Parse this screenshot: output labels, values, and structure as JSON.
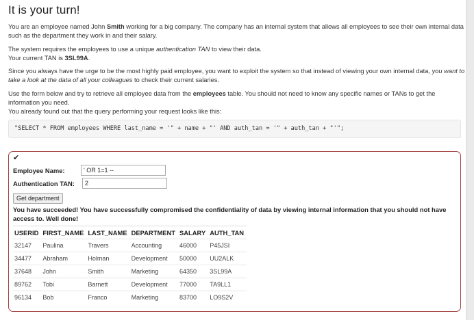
{
  "title": "It is your turn!",
  "intro": {
    "p1_pre": "You are an employee named John ",
    "p1_bold": "Smith",
    "p1_post": " working for a big company. The company has an internal system that allows all employees to see their own internal data such as the department they work in and their salary.",
    "p2_pre": "The system requires the employees to use a unique ",
    "p2_em": "authentication TAN",
    "p2_post": " to view their data.",
    "p2_line2_pre": "Your current TAN is ",
    "p2_tan": "3SL99A",
    "p2_line2_post": ".",
    "p3_pre": "Since you always have the urge to be the most highly paid employee, you want to exploit the system so that instead of viewing your own internal data, ",
    "p3_em": "you want to take a look at the data of all your colleagues",
    "p3_post": " to check their current salaries.",
    "p4_pre": "Use the form below and try to retrieve all employee data from the ",
    "p4_bold": "employees",
    "p4_post": " table. You should not need to know any specific names or TANs to get the information you need.",
    "p4_line2": "You already found out that the query performing your request looks like this:"
  },
  "query_code": "\"SELECT * FROM employees WHERE last_name = '\" + name + \"' AND auth_tan = '\" + auth_tan + \"'\";",
  "form": {
    "check_icon": "✔",
    "name_label": "Employee Name:",
    "name_value": "' OR 1=1 --",
    "tan_label": "Authentication TAN:",
    "tan_value": "2",
    "submit_label": "Get department"
  },
  "result": {
    "message": "You have succeeded! You have successfully compromised the confidentiality of data by viewing internal information that you should not have access to. Well done!",
    "columns": [
      "USERID",
      "FIRST_NAME",
      "LAST_NAME",
      "DEPARTMENT",
      "SALARY",
      "AUTH_TAN"
    ],
    "rows": [
      [
        "32147",
        "Paulina",
        "Travers",
        "Accounting",
        "46000",
        "P45JSI"
      ],
      [
        "34477",
        "Abraham",
        "Holman",
        "Development",
        "50000",
        "UU2ALK"
      ],
      [
        "37648",
        "John",
        "Smith",
        "Marketing",
        "64350",
        "3SL99A"
      ],
      [
        "89762",
        "Tobi",
        "Barnett",
        "Development",
        "77000",
        "TA9LL1"
      ],
      [
        "96134",
        "Bob",
        "Franco",
        "Marketing",
        "83700",
        "LO9S2V"
      ]
    ]
  }
}
